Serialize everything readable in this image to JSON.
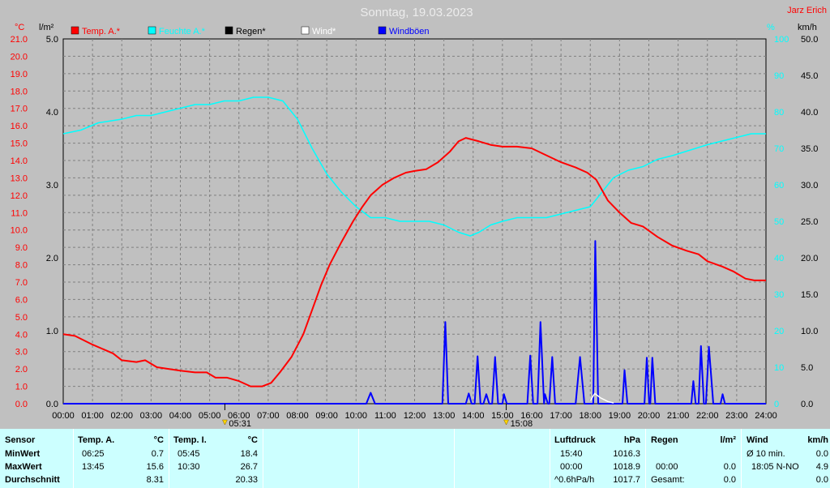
{
  "header": {
    "date": "Sonntag, 19.03.2023",
    "site": "Jarz Erich"
  },
  "chart_data": {
    "type": "line",
    "x_range_hours": [
      0,
      24
    ],
    "x_tick_labels": [
      "00:00",
      "01:00",
      "02:00",
      "03:00",
      "04:00",
      "05:00",
      "06:00",
      "07:00",
      "08:00",
      "09:00",
      "10:00",
      "11:00",
      "12:00",
      "13:00",
      "14:00",
      "15:00",
      "16:00",
      "17:00",
      "18:00",
      "19:00",
      "20:00",
      "21:00",
      "22:00",
      "23:00",
      "24:00"
    ],
    "axes": {
      "temp": {
        "unit": "°C",
        "ylim": [
          0,
          21
        ],
        "ticks": [
          "0.0",
          "1.0",
          "2.0",
          "3.0",
          "4.0",
          "5.0",
          "6.0",
          "7.0",
          "8.0",
          "9.0",
          "10.0",
          "11.0",
          "12.0",
          "13.0",
          "14.0",
          "15.0",
          "16.0",
          "17.0",
          "18.0",
          "19.0",
          "20.0",
          "21.0"
        ]
      },
      "rain": {
        "unit": "l/m²",
        "ylim": [
          0,
          5
        ],
        "ticks": [
          "0.0",
          "1.0",
          "2.0",
          "3.0",
          "4.0",
          "5.0"
        ]
      },
      "humidity": {
        "unit": "%",
        "ylim": [
          0,
          100
        ],
        "ticks": [
          "0",
          "10",
          "20",
          "30",
          "40",
          "50",
          "60",
          "70",
          "80",
          "90",
          "100"
        ]
      },
      "wind": {
        "unit": "km/h",
        "ylim": [
          0,
          50
        ],
        "ticks": [
          "0.0",
          "5.0",
          "10.0",
          "15.0",
          "20.0",
          "25.0",
          "30.0",
          "35.0",
          "40.0",
          "45.0",
          "50.0"
        ]
      }
    },
    "legend": [
      "Temp. A.*",
      "Feuchte A.*",
      "Regen*",
      "Wind*",
      "Windböen"
    ],
    "series": [
      {
        "name": "Temp. A.*",
        "axis": "temp",
        "color": "#ff0000",
        "points": [
          [
            0,
            4.0
          ],
          [
            0.4,
            3.9
          ],
          [
            1,
            3.4
          ],
          [
            1.7,
            2.9
          ],
          [
            2,
            2.5
          ],
          [
            2.5,
            2.4
          ],
          [
            2.8,
            2.5
          ],
          [
            3.2,
            2.1
          ],
          [
            3.6,
            2.0
          ],
          [
            4,
            1.9
          ],
          [
            4.5,
            1.8
          ],
          [
            4.9,
            1.8
          ],
          [
            5.2,
            1.5
          ],
          [
            5.6,
            1.5
          ],
          [
            6,
            1.3
          ],
          [
            6.4,
            1.0
          ],
          [
            6.8,
            1.0
          ],
          [
            7.1,
            1.2
          ],
          [
            7.4,
            1.8
          ],
          [
            7.8,
            2.7
          ],
          [
            8.2,
            4.0
          ],
          [
            8.5,
            5.4
          ],
          [
            8.8,
            6.8
          ],
          [
            9.1,
            8.0
          ],
          [
            9.5,
            9.3
          ],
          [
            9.9,
            10.5
          ],
          [
            10.2,
            11.3
          ],
          [
            10.5,
            12.0
          ],
          [
            10.9,
            12.6
          ],
          [
            11.3,
            13.0
          ],
          [
            11.7,
            13.3
          ],
          [
            12,
            13.4
          ],
          [
            12.4,
            13.5
          ],
          [
            12.8,
            13.9
          ],
          [
            13.2,
            14.5
          ],
          [
            13.5,
            15.1
          ],
          [
            13.75,
            15.3
          ],
          [
            14.2,
            15.1
          ],
          [
            14.6,
            14.9
          ],
          [
            15,
            14.8
          ],
          [
            15.5,
            14.8
          ],
          [
            16,
            14.7
          ],
          [
            16.5,
            14.3
          ],
          [
            17,
            13.9
          ],
          [
            17.5,
            13.6
          ],
          [
            17.9,
            13.3
          ],
          [
            18.2,
            12.9
          ],
          [
            18.6,
            11.7
          ],
          [
            19,
            11.0
          ],
          [
            19.4,
            10.4
          ],
          [
            19.8,
            10.2
          ],
          [
            20.3,
            9.6
          ],
          [
            20.8,
            9.1
          ],
          [
            21.3,
            8.8
          ],
          [
            21.7,
            8.6
          ],
          [
            22,
            8.2
          ],
          [
            22.5,
            7.9
          ],
          [
            22.9,
            7.6
          ],
          [
            23.3,
            7.2
          ],
          [
            23.6,
            7.1
          ],
          [
            24,
            7.1
          ]
        ]
      },
      {
        "name": "Feuchte A.*",
        "axis": "humidity",
        "color": "#00ffff",
        "points": [
          [
            0,
            74
          ],
          [
            0.6,
            75
          ],
          [
            1.2,
            77
          ],
          [
            2,
            78
          ],
          [
            2.5,
            79
          ],
          [
            3,
            79
          ],
          [
            3.5,
            80
          ],
          [
            4,
            81
          ],
          [
            4.5,
            82
          ],
          [
            5,
            82
          ],
          [
            5.5,
            83
          ],
          [
            6,
            83
          ],
          [
            6.5,
            84
          ],
          [
            7,
            84
          ],
          [
            7.5,
            83
          ],
          [
            8,
            78
          ],
          [
            8.5,
            70
          ],
          [
            9,
            63
          ],
          [
            9.5,
            58
          ],
          [
            10,
            54
          ],
          [
            10.5,
            51
          ],
          [
            11,
            51
          ],
          [
            11.5,
            50
          ],
          [
            12,
            50
          ],
          [
            12.5,
            50
          ],
          [
            13,
            49
          ],
          [
            13.5,
            47
          ],
          [
            13.9,
            46
          ],
          [
            14.2,
            47
          ],
          [
            14.6,
            49
          ],
          [
            15,
            50
          ],
          [
            15.5,
            51
          ],
          [
            16,
            51
          ],
          [
            16.5,
            51
          ],
          [
            17,
            52
          ],
          [
            17.5,
            53
          ],
          [
            18,
            54
          ],
          [
            18.4,
            58
          ],
          [
            18.8,
            62
          ],
          [
            19.3,
            64
          ],
          [
            19.8,
            65
          ],
          [
            20.3,
            67
          ],
          [
            20.8,
            68
          ],
          [
            21.2,
            69
          ],
          [
            21.6,
            70
          ],
          [
            22,
            71
          ],
          [
            22.5,
            72
          ],
          [
            23,
            73
          ],
          [
            23.5,
            74
          ],
          [
            24,
            74
          ]
        ]
      },
      {
        "name": "Windböen",
        "axis": "wind",
        "color": "#0000ff",
        "points": [
          [
            0,
            0
          ],
          [
            10.35,
            0
          ],
          [
            10.5,
            1.5
          ],
          [
            10.65,
            0
          ],
          [
            12.95,
            0
          ],
          [
            13.05,
            11.2
          ],
          [
            13.15,
            0
          ],
          [
            13.75,
            0
          ],
          [
            13.85,
            1.4
          ],
          [
            13.95,
            0
          ],
          [
            14.05,
            0
          ],
          [
            14.15,
            6.5
          ],
          [
            14.25,
            0
          ],
          [
            14.35,
            0
          ],
          [
            14.45,
            1.3
          ],
          [
            14.55,
            0
          ],
          [
            14.65,
            0
          ],
          [
            14.75,
            6.4
          ],
          [
            14.85,
            0
          ],
          [
            15,
            0
          ],
          [
            15.05,
            1.3
          ],
          [
            15.15,
            0
          ],
          [
            15.85,
            0
          ],
          [
            15.95,
            6.6
          ],
          [
            16.05,
            0
          ],
          [
            16.2,
            0
          ],
          [
            16.3,
            11.2
          ],
          [
            16.42,
            0
          ],
          [
            16.45,
            1.3
          ],
          [
            16.55,
            0
          ],
          [
            16.6,
            0
          ],
          [
            16.7,
            6.4
          ],
          [
            16.8,
            0
          ],
          [
            17.5,
            0
          ],
          [
            17.65,
            6.4
          ],
          [
            17.8,
            0
          ],
          [
            18.1,
            0
          ],
          [
            18.17,
            22.3
          ],
          [
            18.27,
            0
          ],
          [
            19.1,
            0
          ],
          [
            19.17,
            4.6
          ],
          [
            19.27,
            0
          ],
          [
            19.85,
            0
          ],
          [
            19.93,
            6.3
          ],
          [
            20.01,
            0
          ],
          [
            20.05,
            0
          ],
          [
            20.12,
            6.3
          ],
          [
            20.22,
            0
          ],
          [
            21.45,
            0
          ],
          [
            21.52,
            3.1
          ],
          [
            21.6,
            0
          ],
          [
            21.7,
            0
          ],
          [
            21.78,
            7.9
          ],
          [
            21.88,
            0
          ],
          [
            21.95,
            0
          ],
          [
            22.05,
            7.8
          ],
          [
            22.2,
            0
          ],
          [
            22.45,
            0
          ],
          [
            22.52,
            1.3
          ],
          [
            22.6,
            0
          ],
          [
            24,
            0
          ]
        ]
      },
      {
        "name": "Wind*",
        "axis": "wind",
        "color": "#ffffff",
        "points": [
          [
            18,
            0.4
          ],
          [
            18.15,
            1.4
          ],
          [
            18.35,
            0.8
          ],
          [
            18.6,
            0.3
          ],
          [
            18.8,
            0.1
          ]
        ]
      }
    ],
    "markers": [
      {
        "label": "05:31",
        "hour": 5.52,
        "type": "sunrise"
      },
      {
        "label": "15:08",
        "hour": 15.13,
        "type": "sunset"
      }
    ]
  },
  "stats": {
    "col1": {
      "title": "Sensor",
      "rows": [
        "MinWert",
        "MaxWert",
        "Durchschnitt"
      ]
    },
    "col2": {
      "title": "Temp. A.",
      "unit": "°C",
      "rows": [
        [
          "06:25",
          "0.7"
        ],
        [
          "13:45",
          "15.6"
        ],
        [
          "",
          "8.31"
        ]
      ]
    },
    "col3": {
      "title": "Temp. I.",
      "unit": "°C",
      "rows": [
        [
          "05:45",
          "18.4"
        ],
        [
          "10:30",
          "26.7"
        ],
        [
          "",
          "20.33"
        ]
      ]
    },
    "col4": {
      "title": "Luftdruck",
      "unit": "hPa",
      "rows": [
        [
          "15:40",
          "1016.3"
        ],
        [
          "00:00",
          "1018.9"
        ],
        [
          "^0.6hPa/h",
          "1017.7"
        ]
      ]
    },
    "col5": {
      "title": "Regen",
      "unit": "l/m²",
      "rows": [
        [
          "00:00",
          "0.0"
        ],
        [
          "Gesamt:",
          "0.0"
        ]
      ]
    },
    "col6": {
      "title": "Wind",
      "unit": "km/h",
      "rows": [
        [
          "Ø 10 min.",
          "0.0"
        ],
        [
          "18:05  N-NO",
          "4.9"
        ],
        [
          "",
          "0.0"
        ]
      ]
    }
  },
  "colors": {
    "temp": "#ff0000",
    "humidity": "#00ffff",
    "rain": "#000000",
    "wind": "#ffffff",
    "gust": "#0000ff",
    "plot_bg": "#c0c0c0",
    "grid": "#808080",
    "stats_bg": "#ccffff"
  }
}
